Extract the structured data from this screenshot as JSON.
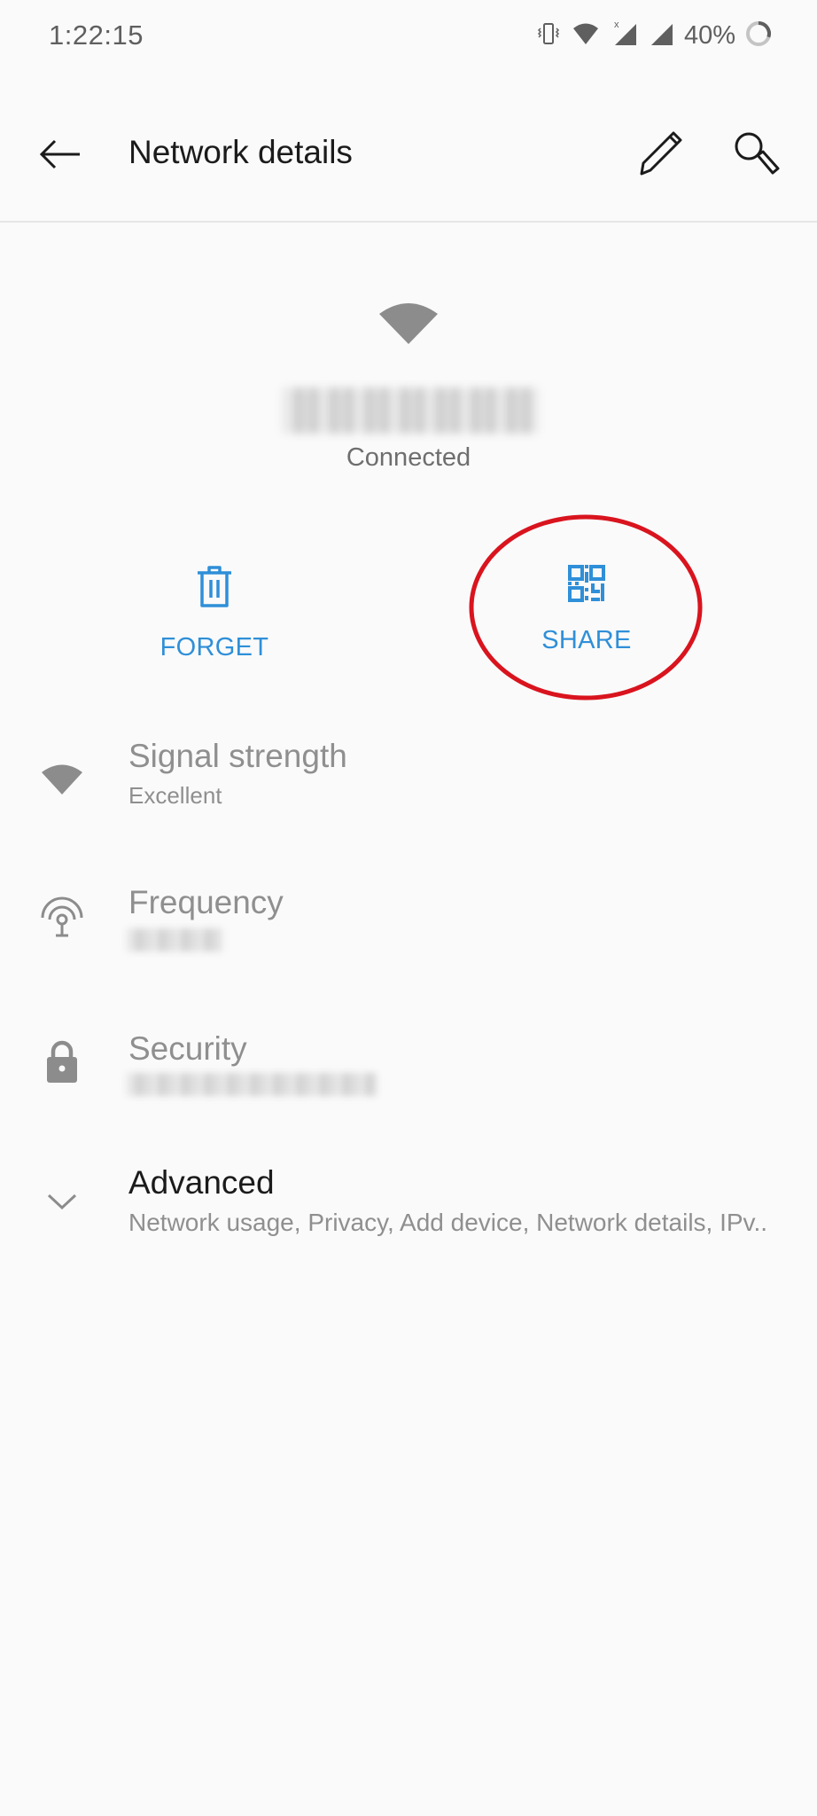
{
  "status_bar": {
    "time": "1:22:15",
    "battery_percent": "40%",
    "icons": [
      "vibrate-icon",
      "wifi-icon",
      "signal-no-data-icon",
      "signal-icon",
      "battery-ring-icon"
    ]
  },
  "app_bar": {
    "title": "Network details",
    "back_icon": "arrow-left-icon",
    "edit_icon": "pencil-icon",
    "search_icon": "search-icon"
  },
  "network": {
    "ssid": "[redacted]",
    "status": "Connected"
  },
  "actions": [
    {
      "label": "FORGET",
      "icon": "trash-icon"
    },
    {
      "label": "SHARE",
      "icon": "qr-code-icon",
      "highlighted": true
    }
  ],
  "details": [
    {
      "title": "Signal strength",
      "value": "Excellent",
      "icon": "wifi-icon",
      "value_redacted": false
    },
    {
      "title": "Frequency",
      "value": "[redacted]",
      "icon": "antenna-icon",
      "value_redacted": true
    },
    {
      "title": "Security",
      "value": "[redacted]",
      "icon": "lock-icon",
      "value_redacted": true
    },
    {
      "title": "Advanced",
      "value": "Network usage, Privacy, Add device, Network details, IPv..",
      "icon": "chevron-down-icon",
      "value_redacted": false
    }
  ],
  "colors": {
    "accent": "#2f8fd8",
    "annotation": "#d9141e",
    "background": "#fafafa",
    "muted_text": "#8f8f8f"
  }
}
